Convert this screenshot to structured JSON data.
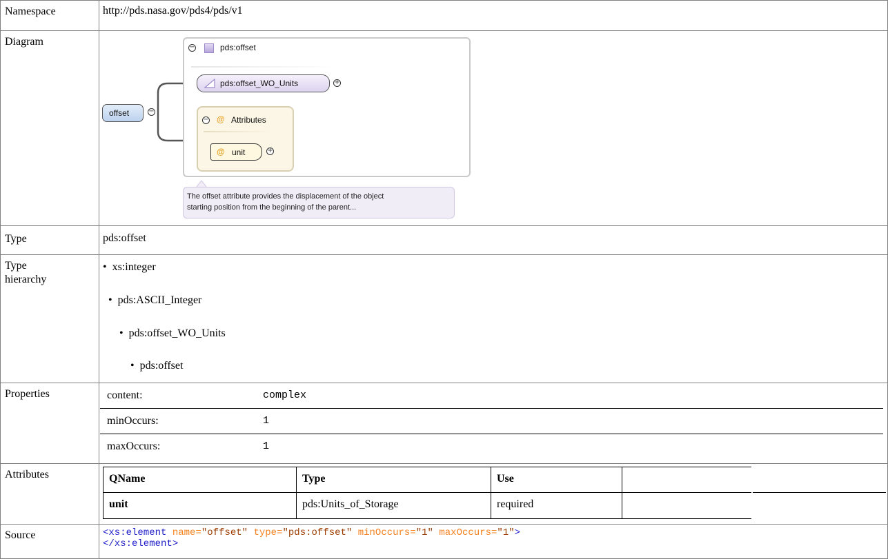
{
  "rows": {
    "namespace": {
      "label": "Namespace",
      "value": "http://pds.nasa.gov/pds4/pds/v1"
    },
    "diagram": {
      "label": "Diagram",
      "type_name": "pds:offset",
      "base_name": "pds:offset_WO_Units",
      "attributes_label": "Attributes",
      "attribute_name": "unit",
      "element_name": "offset",
      "tooltip_line1": "The offset attribute provides the displacement of the object",
      "tooltip_line2": "starting position from the beginning of the parent..."
    },
    "type": {
      "label": "Type",
      "value": "pds:offset"
    },
    "hierarchy": {
      "label": "Type hierarchy",
      "items": [
        "xs:integer",
        "pds:ASCII_Integer",
        "pds:offset_WO_Units",
        "pds:offset"
      ]
    },
    "properties": {
      "label": "Properties",
      "items": [
        {
          "key": "content:",
          "value": "complex"
        },
        {
          "key": "minOccurs:",
          "value": "1"
        },
        {
          "key": "maxOccurs:",
          "value": "1"
        }
      ]
    },
    "attributes": {
      "label": "Attributes",
      "headers": [
        "QName",
        "Type",
        "Use"
      ],
      "rows": [
        {
          "qname": "unit",
          "type": "pds:Units_of_Storage",
          "use": "required"
        }
      ]
    },
    "source": {
      "label": "Source",
      "open_tag": "<xs:element",
      "attrs": [
        {
          "name": "name",
          "value": "\"offset\""
        },
        {
          "name": "type",
          "value": "\"pds:offset\""
        },
        {
          "name": "minOccurs",
          "value": "\"1\""
        },
        {
          "name": "maxOccurs",
          "value": "\"1\""
        }
      ],
      "open_end": ">",
      "close_tag": "</xs:element>"
    }
  },
  "colors": {
    "border": "#7f7f7f",
    "source_tag": "#1e1ec8",
    "source_attr_name": "#f58220",
    "source_attr_value": "#9c3c00"
  }
}
